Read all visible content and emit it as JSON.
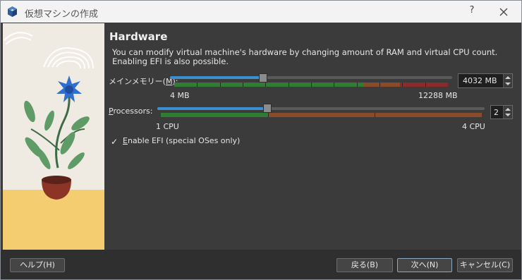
{
  "window": {
    "title": "仮想マシンの作成",
    "help_glyph": "?",
    "app_icon": "virtualbox-cube-icon",
    "close_icon": "close-icon"
  },
  "colors": {
    "accent": "#3b8fd0",
    "good": "#2f7d32",
    "warn": "#8a4b2a",
    "bad": "#8b2a2a",
    "panel": "#3b3b3b"
  },
  "main": {
    "heading": "Hardware",
    "description": "You can modify virtual machine's hardware by changing amount of RAM and virtual CPU count. Enabling EFI is also possible.",
    "memory": {
      "label_pre": "メインメモリー(",
      "label_key": "M",
      "label_post": "):",
      "value": "4032 MB",
      "min_label": "4 MB",
      "max_label": "12288 MB",
      "min": 4,
      "max": 12288,
      "current": 4032
    },
    "processors": {
      "label_key": "P",
      "label_rest": "rocessors:",
      "value": "2",
      "min_label": "1 CPU",
      "max_label": "4 CPU",
      "min": 1,
      "max": 4,
      "current": 2
    },
    "efi": {
      "checked": true,
      "label_key": "E",
      "label_rest": "nable EFI (special OSes only)"
    }
  },
  "footer": {
    "help_label": "ヘルプ(H)",
    "back_label": "戻る(B)",
    "next_label": "次へ(N)",
    "cancel_label": "キャンセル(C)"
  }
}
